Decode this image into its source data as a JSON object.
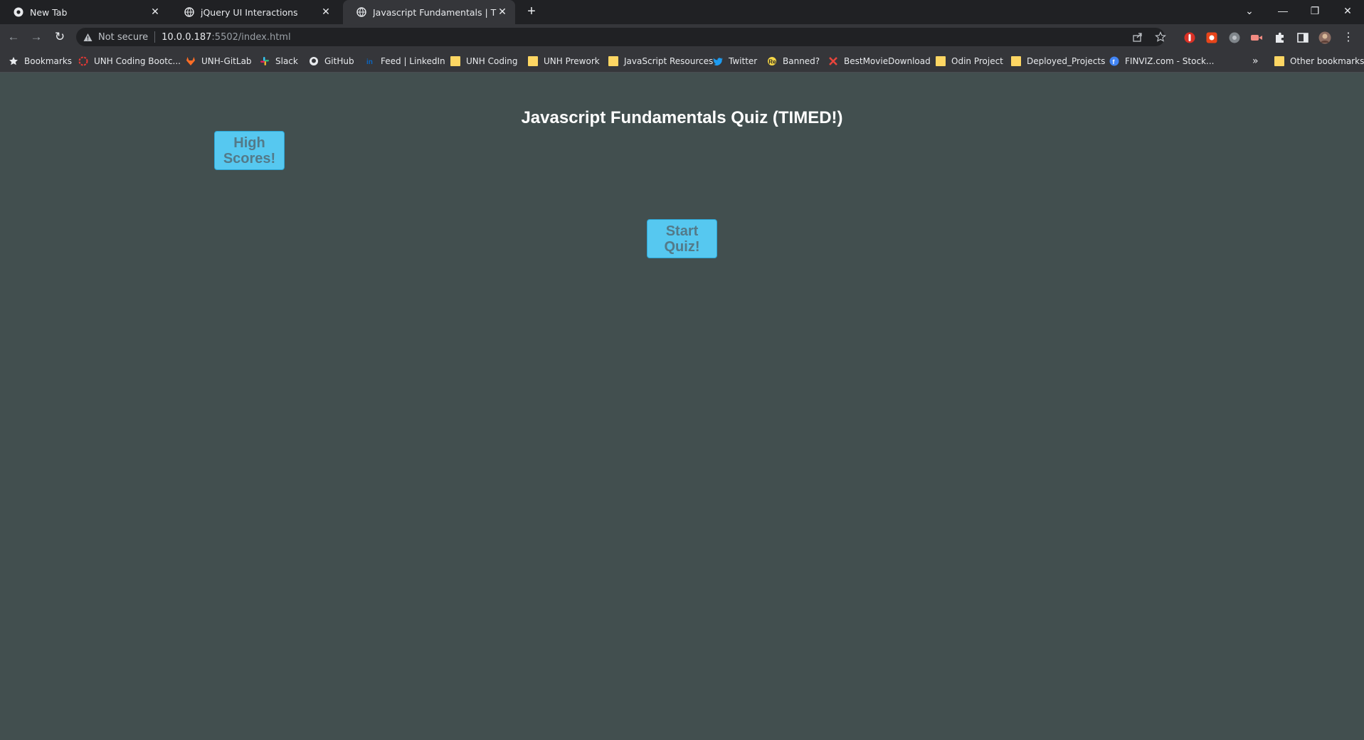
{
  "browser": {
    "tabs": [
      {
        "title": "New Tab",
        "active": false
      },
      {
        "title": "jQuery UI Interactions",
        "active": false
      },
      {
        "title": "Javascript Fundamentals | Timed",
        "active": true
      }
    ],
    "address": {
      "security": "Not secure",
      "host": "10.0.0.187",
      "rest": ":5502/index.html"
    },
    "bookmarks": [
      {
        "label": "Bookmarks",
        "icon": "star-icon"
      },
      {
        "label": "UNH Coding Bootc...",
        "icon": "bootcamp-icon"
      },
      {
        "label": "UNH-GitLab",
        "icon": "gitlab-icon"
      },
      {
        "label": "Slack",
        "icon": "slack-icon"
      },
      {
        "label": "GitHub",
        "icon": "github-icon"
      },
      {
        "label": "Feed | LinkedIn",
        "icon": "linkedin-icon"
      },
      {
        "label": "UNH Coding",
        "icon": "folder-icon"
      },
      {
        "label": "UNH Prework",
        "icon": "folder-icon"
      },
      {
        "label": "JavaScript Resources",
        "icon": "folder-icon"
      },
      {
        "label": "Twitter",
        "icon": "twitter-icon"
      },
      {
        "label": "Banned?",
        "icon": "banned-icon"
      },
      {
        "label": "BestMovieDownload",
        "icon": "x-icon"
      },
      {
        "label": "Odin Project",
        "icon": "folder-icon"
      },
      {
        "label": "Deployed_Projects",
        "icon": "folder-icon"
      },
      {
        "label": "FINVIZ.com - Stock...",
        "icon": "finviz-icon"
      }
    ],
    "overflow": "»",
    "other_bookmarks": "Other bookmarks"
  },
  "page": {
    "title": "Javascript Fundamentals Quiz (TIMED!)",
    "high_scores_label": "High Scores!",
    "start_label": "Start Quiz!"
  },
  "colors": {
    "page_background": "#424f4f",
    "button": "#56c8f0",
    "button_text": "#537a89"
  }
}
